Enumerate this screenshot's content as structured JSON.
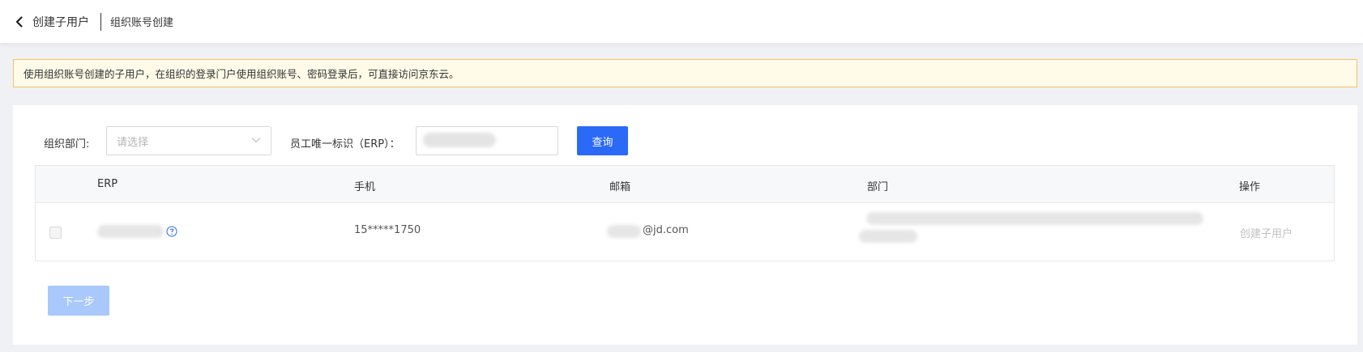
{
  "header": {
    "back_label": "创建子用户",
    "current": "组织账号创建"
  },
  "notice": {
    "text": "使用组织账号创建的子用户，在组织的登录门户使用组织账号、密码登录后，可直接访问京东云。"
  },
  "filters": {
    "dept_label": "组织部门:",
    "dept_placeholder": "请选择",
    "erp_label": "员工唯一标识（ERP）：",
    "erp_value": "",
    "query_label": "查询"
  },
  "table": {
    "columns": [
      "ERP",
      "手机",
      "邮箱",
      "部门",
      "操作"
    ],
    "rows": [
      {
        "erp": "",
        "phone": "15*****1750",
        "email": "@jd.com",
        "dept": "",
        "action": "创建子用户"
      }
    ]
  },
  "footer": {
    "next_label": "下一步"
  },
  "colors": {
    "primary": "#2b6af7",
    "primary_disabled": "#a9c8fb",
    "notice_bg": "#fffbe8",
    "notice_border": "#f7c266"
  }
}
